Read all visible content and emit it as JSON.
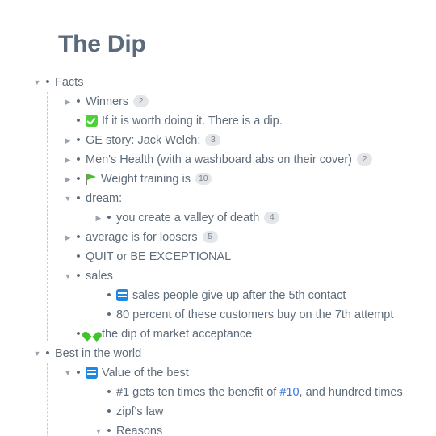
{
  "document": {
    "title": "The Dip"
  },
  "colors": {
    "title": "#5b6b7c",
    "text": "#5e6c7a",
    "link": "#3b77d8",
    "badge_bg": "#e4e6e9",
    "badge_text": "#7d868f",
    "guide_line": "#c9ccd1",
    "accent_green": "#3fc42b",
    "accent_blue": "#1e88e5"
  },
  "outline": {
    "rows": [
      {
        "id": "facts",
        "depth": 0,
        "toggle": "expanded",
        "bullet": true,
        "icon": null,
        "text": "Facts",
        "badge": null
      },
      {
        "id": "winners",
        "depth": 1,
        "toggle": "collapsed",
        "bullet": true,
        "icon": null,
        "text": "Winners",
        "badge": "2"
      },
      {
        "id": "worth-doing",
        "depth": 1,
        "toggle": "none",
        "bullet": true,
        "icon": "white-check-mark-icon",
        "text": "If it is worth doing it. There is a dip.",
        "badge": null
      },
      {
        "id": "ge-story",
        "depth": 1,
        "toggle": "collapsed",
        "bullet": true,
        "icon": null,
        "text": "GE story: Jack Welch:",
        "badge": "3"
      },
      {
        "id": "mens-health",
        "depth": 1,
        "toggle": "collapsed",
        "bullet": true,
        "icon": null,
        "text": "Men's Health (with a washboard abs on their cover)",
        "badge": "2"
      },
      {
        "id": "weight-training",
        "depth": 1,
        "toggle": "collapsed",
        "bullet": true,
        "icon": "green-flag-icon",
        "text": "Weight training is",
        "badge": "10"
      },
      {
        "id": "dream",
        "depth": 1,
        "toggle": "expanded",
        "bullet": true,
        "icon": null,
        "text": "dream:",
        "badge": null
      },
      {
        "id": "valley-of-death",
        "depth": 2,
        "toggle": "collapsed",
        "bullet": true,
        "icon": null,
        "text": "you create a valley of death",
        "badge": "4"
      },
      {
        "id": "average-loosers",
        "depth": 1,
        "toggle": "collapsed",
        "bullet": true,
        "icon": null,
        "text": "average is for loosers",
        "badge": "5"
      },
      {
        "id": "quit-or-be-exceptional",
        "depth": 1,
        "toggle": "none",
        "bullet": true,
        "icon": null,
        "text": "QUIT or BE EXCEPTIONAL",
        "badge": null
      },
      {
        "id": "sales",
        "depth": 1,
        "toggle": "expanded",
        "bullet": true,
        "icon": null,
        "text": "sales",
        "badge": null
      },
      {
        "id": "sales-give-up",
        "depth": 2,
        "toggle": "none",
        "bullet": true,
        "icon": "blue-card-icon",
        "text": "sales people give up after the 5th contact",
        "badge": null
      },
      {
        "id": "80-percent",
        "depth": 2,
        "toggle": "none",
        "bullet": true,
        "icon": null,
        "text": "80 percent of these customers buy on the 7th attempt",
        "badge": null
      },
      {
        "id": "dip-market-acceptance",
        "depth": 1,
        "toggle": "none",
        "bullet": true,
        "icon": "green-heart-icon",
        "text": "the dip of market acceptance",
        "badge": null
      },
      {
        "id": "best-in-the-world",
        "depth": 0,
        "toggle": "expanded",
        "bullet": true,
        "icon": null,
        "text": "Best in the world",
        "badge": null
      },
      {
        "id": "value-of-the-best",
        "depth": 1,
        "toggle": "expanded",
        "bullet": true,
        "icon": "blue-card-icon",
        "text": "Value of the best",
        "badge": null
      },
      {
        "id": "number-one-benefit",
        "depth": 2,
        "toggle": "none",
        "bullet": true,
        "icon": null,
        "text_parts": [
          {
            "t": "#1 gets ten times the benefit of ",
            "link": false
          },
          {
            "t": "#10",
            "link": true
          },
          {
            "t": ", and hundred times",
            "link": false
          }
        ],
        "text": "#1 gets ten times the benefit of #10, and hundred times",
        "badge": null
      },
      {
        "id": "zipfs-law",
        "depth": 2,
        "toggle": "none",
        "bullet": true,
        "icon": null,
        "text": "zipf's law",
        "badge": null
      },
      {
        "id": "reasons",
        "depth": 2,
        "toggle": "expanded",
        "bullet": true,
        "icon": null,
        "text": "Reasons",
        "badge": null
      }
    ]
  }
}
